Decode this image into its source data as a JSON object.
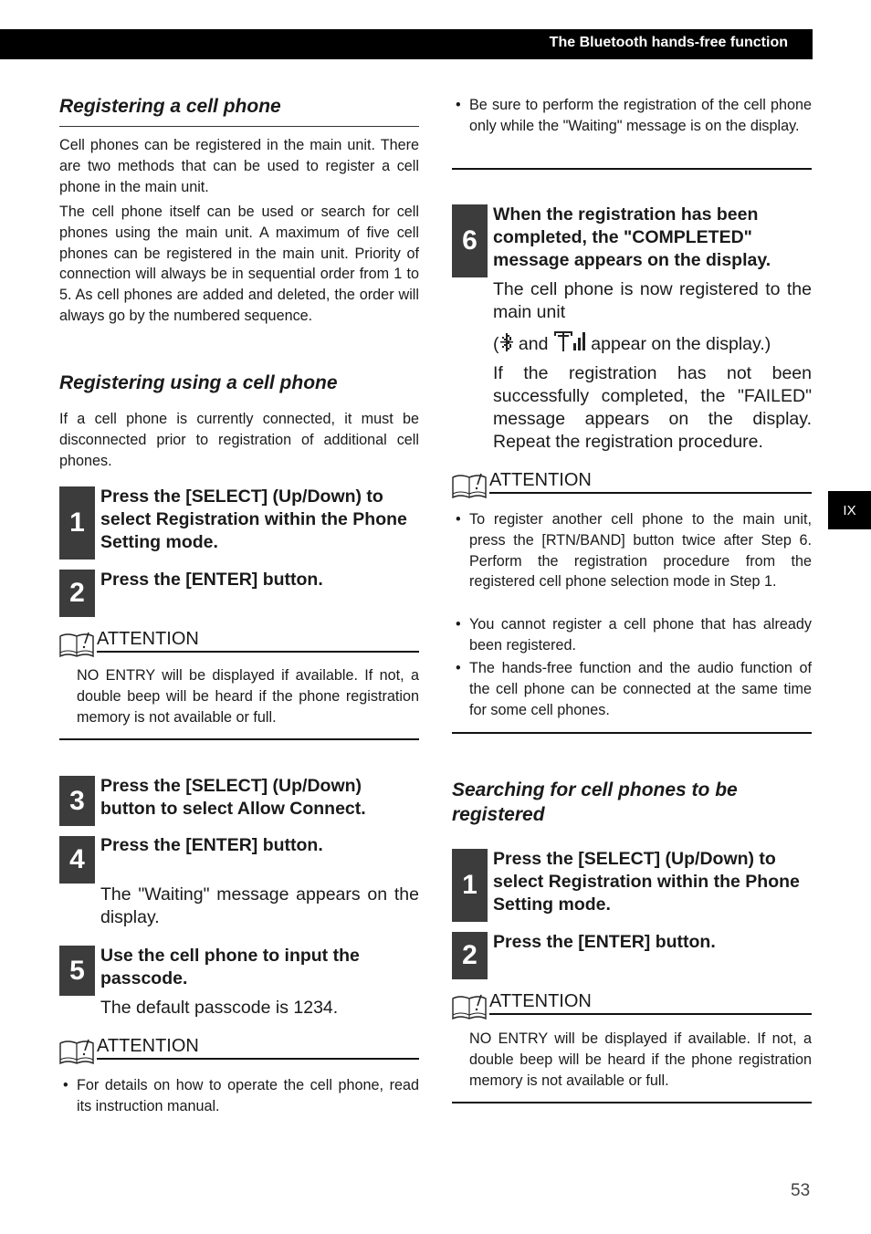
{
  "header": {
    "title": "The Bluetooth hands-free function"
  },
  "side_tab": {
    "label": "IX"
  },
  "page_number": "53",
  "left": {
    "section1": {
      "title": "Registering a cell phone",
      "p1": "Cell phones can be registered in the main unit. There are two methods that can be used to register a cell phone in the main unit.",
      "p2": "The cell phone itself can be used or search for cell phones using the main unit. A maximum of five cell phones can be registered in the main unit. Priority of connection will always be in sequential order from 1 to 5. As cell phones are added and deleted, the order will always go by the numbered sequence."
    },
    "section2": {
      "title": "Registering using a cell phone",
      "p1": "If a cell phone is currently connected, it must be disconnected prior to registration of additional cell phones."
    },
    "steps": [
      {
        "num": "1",
        "text": "Press the [SELECT] (Up/Down) to select Registration within the Phone Setting mode."
      },
      {
        "num": "2",
        "text": "Press the [ENTER] button."
      },
      {
        "num": "3",
        "text": "Press the [SELECT] (Up/Down) button to select Allow Connect."
      },
      {
        "num": "4",
        "text": "Press the [ENTER] button.",
        "note": "The \"Waiting\" message appears on the display."
      },
      {
        "num": "5",
        "text": "Use the cell phone to input the passcode.",
        "note": "The default passcode is 1234."
      }
    ],
    "attention1": {
      "label": "ATTENTION",
      "text": "NO ENTRY will be displayed if available. If not, a double beep will be heard if the phone registration memory is not available or full."
    },
    "attention2": {
      "label": "ATTENTION",
      "bullets": [
        "For details on how to operate the cell phone, read its instruction manual."
      ]
    }
  },
  "right": {
    "top_bullets": [
      "Be sure to perform the registration of the cell phone only while the \"Waiting\" message is on the display."
    ],
    "step6": {
      "num": "6",
      "text": "When the registration has been completed, the \"COMPLETED\" message appears on the display.",
      "note1": "The cell phone is now registered to the main unit",
      "note2_pre": "(",
      "note2_and": " and ",
      "note2_post": " appear on the display.)",
      "icons": [
        "bluetooth-icon",
        "signal-strength-icon"
      ],
      "note3": "If the registration has not been successfully completed, the \"FAILED\" message appears on the display. Repeat the registration procedure."
    },
    "attention3": {
      "label": "ATTENTION",
      "bullets": [
        "To register another cell phone to the main unit, press the [RTN/BAND] button twice after Step 6. Perform the registration procedure from the registered cell phone selection mode in Step 1.",
        "You cannot register a cell phone that has already been registered.",
        "The hands-free function and the audio function of the cell phone can be connected at the same time for some cell phones."
      ]
    },
    "section3": {
      "title": "Searching for cell phones to be registered"
    },
    "steps": [
      {
        "num": "1",
        "text": "Press the [SELECT] (Up/Down) to select Registration within the Phone Setting mode."
      },
      {
        "num": "2",
        "text": "Press the [ENTER] button."
      }
    ],
    "attention4": {
      "label": "ATTENTION",
      "text": "NO ENTRY will be displayed if available. If not, a double beep will be heard if the phone registration memory is not available or full."
    }
  }
}
